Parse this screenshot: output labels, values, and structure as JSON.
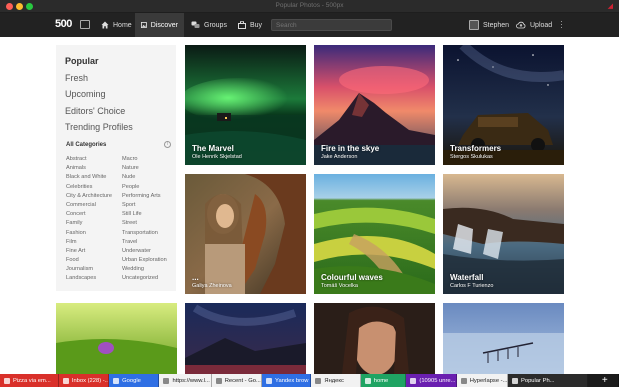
{
  "window": {
    "title": "Popular Photos - 500px"
  },
  "nav": {
    "logo": "500",
    "home": "Home",
    "discover": "Discover",
    "groups": "Groups",
    "buy": "Buy",
    "search_placeholder": "Search",
    "user": "Stephen",
    "upload": "Upload"
  },
  "sidebar": {
    "items": [
      "Popular",
      "Fresh",
      "Upcoming",
      "Editors' Choice",
      "Trending Profiles"
    ],
    "categories_title": "All Categories",
    "categories_left": [
      "Abstract",
      "Animals",
      "Black and White",
      "Celebrities",
      "City & Architecture",
      "Commercial",
      "Concert",
      "Family",
      "Fashion",
      "Film",
      "Fine Art",
      "Food",
      "Journalism",
      "Landscapes"
    ],
    "categories_right": [
      "Macro",
      "Nature",
      "Nude",
      "People",
      "Performing Arts",
      "Sport",
      "Still Life",
      "Street",
      "Transportation",
      "Travel",
      "Underwater",
      "Urban Exploration",
      "Wedding",
      "Uncategorized"
    ]
  },
  "photos": [
    {
      "title": "The Marvel",
      "author": "Ole Henrik Skjelstad"
    },
    {
      "title": "Fire in the skye",
      "author": "Jake Anderson"
    },
    {
      "title": "Transformers",
      "author": "Stergos Skulukas"
    },
    {
      "title": "...",
      "author": "Galiya Zheinova"
    },
    {
      "title": "Colourful waves",
      "author": "Tomáš Vocelka"
    },
    {
      "title": "Waterfall",
      "author": "Carlos F Turienzo"
    }
  ],
  "taskbar": [
    {
      "label": "Pizza via em...",
      "color": "#d9302a"
    },
    {
      "label": "Inbox (228) -...",
      "color": "#d9302a"
    },
    {
      "label": "Google",
      "color": "#2f6fe4"
    },
    {
      "label": "https://www.l...",
      "color": "#f2f2f2"
    },
    {
      "label": "Recent - Go...",
      "color": "#f2f2f2"
    },
    {
      "label": "Yandex brow",
      "color": "#2f6fe4"
    },
    {
      "label": "Яндекс",
      "color": "#f2f2f2"
    },
    {
      "label": "home",
      "color": "#1fa463"
    },
    {
      "label": "(10905 unre...",
      "color": "#6a1fb0"
    },
    {
      "label": "Hyperlapse -...",
      "color": "#f2f2f2"
    },
    {
      "label": "Popular Ph...",
      "color": "#2b2b2b"
    }
  ]
}
